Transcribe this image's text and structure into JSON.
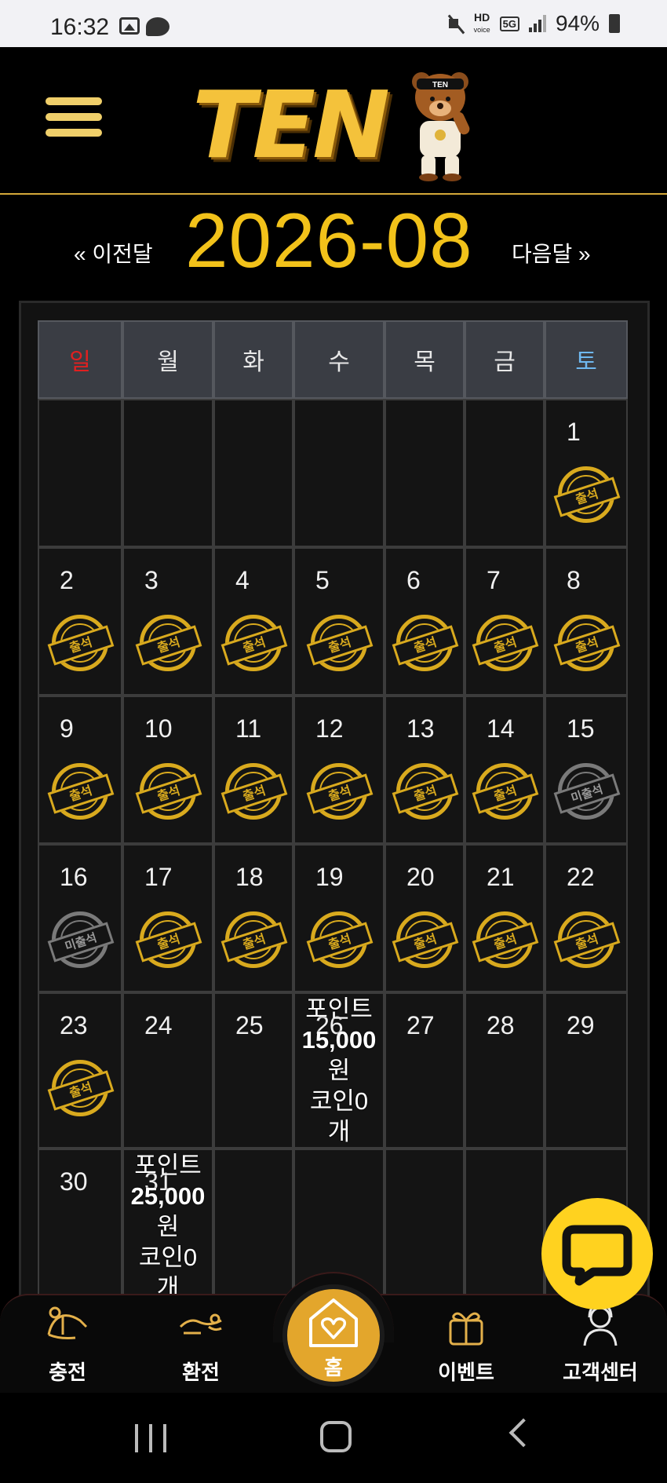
{
  "status_bar": {
    "time": "16:32",
    "hd_label": "HD",
    "voice_label": "voice",
    "network_label": "5G",
    "battery": "94%"
  },
  "header": {
    "logo_text": "TEN",
    "bear_badge": "TEN"
  },
  "calendar": {
    "prev_label": "« 이전달",
    "month": "2026-08",
    "next_label": "다음달 »",
    "weekdays": [
      "일",
      "월",
      "화",
      "수",
      "목",
      "금",
      "토"
    ],
    "weekday_colors": [
      "#e02020",
      "#e8e8e8",
      "#e8e8e8",
      "#e8e8e8",
      "#e8e8e8",
      "#e8e8e8",
      "#6fb8f0"
    ],
    "attended_label": "출석",
    "missed_label": "미출석",
    "weeks": [
      [
        null,
        null,
        null,
        null,
        null,
        null,
        {
          "day": "1",
          "stamp": "attended"
        }
      ],
      [
        {
          "day": "2",
          "stamp": "attended"
        },
        {
          "day": "3",
          "stamp": "attended"
        },
        {
          "day": "4",
          "stamp": "attended"
        },
        {
          "day": "5",
          "stamp": "attended"
        },
        {
          "day": "6",
          "stamp": "attended"
        },
        {
          "day": "7",
          "stamp": "attended"
        },
        {
          "day": "8",
          "stamp": "attended"
        }
      ],
      [
        {
          "day": "9",
          "stamp": "attended"
        },
        {
          "day": "10",
          "stamp": "attended"
        },
        {
          "day": "11",
          "stamp": "attended"
        },
        {
          "day": "12",
          "stamp": "attended"
        },
        {
          "day": "13",
          "stamp": "attended"
        },
        {
          "day": "14",
          "stamp": "attended"
        },
        {
          "day": "15",
          "stamp": "missed"
        }
      ],
      [
        {
          "day": "16",
          "stamp": "missed"
        },
        {
          "day": "17",
          "stamp": "attended"
        },
        {
          "day": "18",
          "stamp": "attended"
        },
        {
          "day": "19",
          "stamp": "attended"
        },
        {
          "day": "20",
          "stamp": "attended"
        },
        {
          "day": "21",
          "stamp": "attended"
        },
        {
          "day": "22",
          "stamp": "attended"
        }
      ],
      [
        {
          "day": "23",
          "stamp": "attended"
        },
        {
          "day": "24"
        },
        {
          "day": "25"
        },
        {
          "day": "26",
          "reward": {
            "line1": "포인트",
            "line2": "15,000",
            "line3": "원",
            "line4": "코인0",
            "line5": "개"
          }
        },
        {
          "day": "27"
        },
        {
          "day": "28"
        },
        {
          "day": "29"
        }
      ],
      [
        {
          "day": "30"
        },
        {
          "day": "31",
          "reward": {
            "line1": "포인트",
            "line2": "25,000",
            "line3": "원",
            "line4": "코인0",
            "line5": "개"
          }
        },
        null,
        null,
        null,
        null,
        null
      ]
    ]
  },
  "bottom_nav": {
    "deposit_label": "충전",
    "withdraw_label": "환전",
    "home_label": "홈",
    "event_label": "이벤트",
    "support_label": "고객센터"
  },
  "colors": {
    "accent_gold": "#f2c21a",
    "stamp_gold": "#d9aa1e",
    "stamp_gray": "#7a7a7a",
    "fab_yellow": "#ffd21f",
    "home_orange": "#e3a62c"
  }
}
